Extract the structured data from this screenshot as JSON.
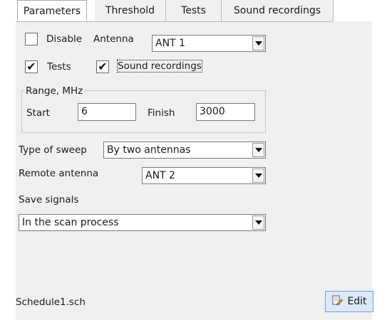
{
  "tabs": [
    {
      "label": "Parameters",
      "active": true
    },
    {
      "label": "Threshold",
      "active": false
    },
    {
      "label": "Tests",
      "active": false
    },
    {
      "label": "Sound recordings",
      "active": false
    }
  ],
  "disable": {
    "label": "Disable",
    "checked": false
  },
  "antenna": {
    "label": "Antenna",
    "value": "ANT 1"
  },
  "tests_check": {
    "label": "Tests",
    "checked": true
  },
  "sound_check": {
    "label": "Sound recordings",
    "checked": true
  },
  "range": {
    "title": "Range, MHz",
    "start_label": "Start",
    "start_value": "6",
    "finish_label": "Finish",
    "finish_value": "3000"
  },
  "sweep": {
    "label": "Type of sweep",
    "value": "By two antennas"
  },
  "remote": {
    "label": "Remote antenna",
    "value": "ANT 2"
  },
  "save_signals": {
    "label": "Save signals",
    "value": "In the scan process"
  },
  "footer": {
    "filename": "Schedule1.sch",
    "edit_label": "Edit"
  },
  "icons": {
    "check": "✔",
    "edit_icon": "edit-icon"
  },
  "colors": {
    "panel_bg": "#f0f0f0",
    "button_bg": "#dbe9f8",
    "button_border": "#6f9fd8"
  }
}
